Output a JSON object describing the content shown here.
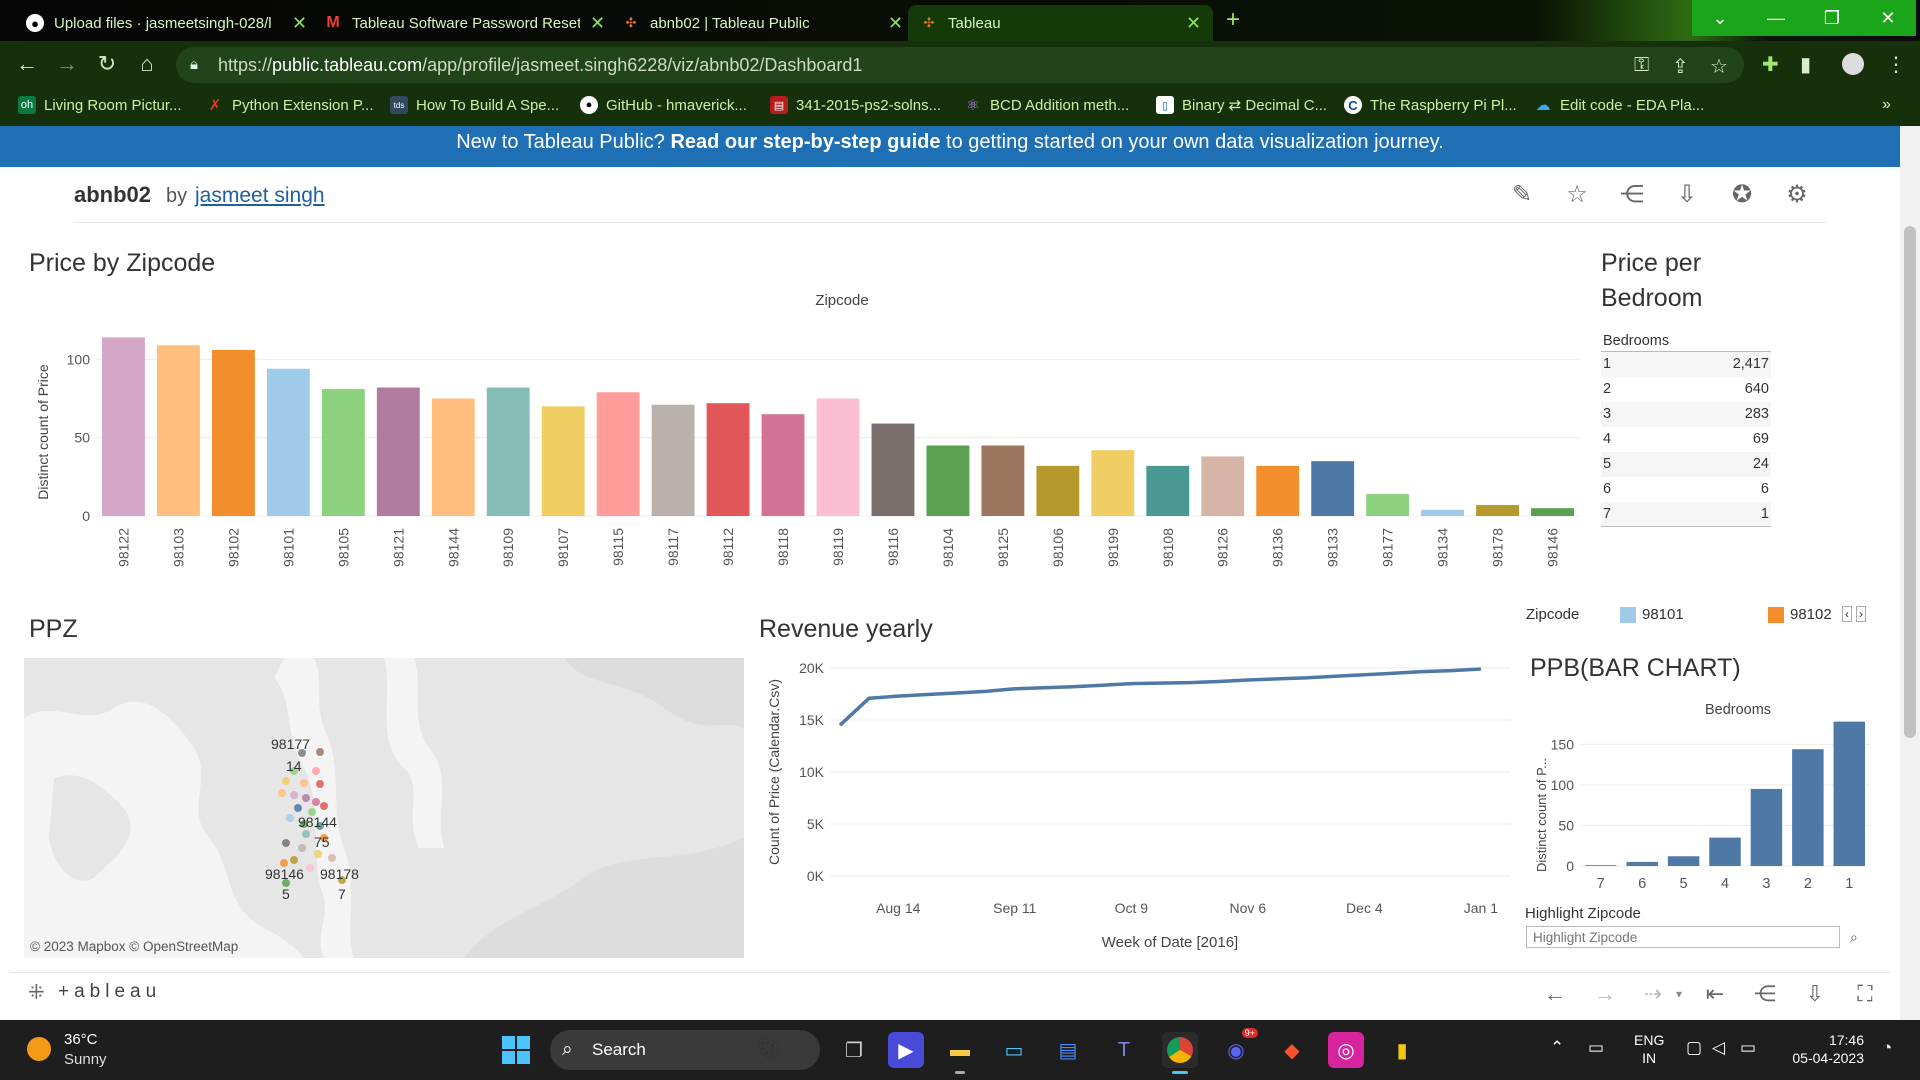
{
  "browser": {
    "tabs": [
      {
        "title": "Upload files · jasmeetsingh-028/l",
        "favicon": "github-icon",
        "active": false
      },
      {
        "title": "Tableau Software Password Reset",
        "favicon": "gmail-icon",
        "active": false
      },
      {
        "title": "abnb02 | Tableau Public",
        "favicon": "tableau-icon",
        "active": false
      },
      {
        "title": "Tableau",
        "favicon": "tableau-icon",
        "active": true
      }
    ],
    "url_prefix": "https://",
    "url_host": "public.tableau.com",
    "url_path": "/app/profile/jasmeet.singh6228/viz/abnb02/Dashboard1",
    "bookmarks": [
      {
        "label": "Living Room Pictur...",
        "icon": "oh-icon",
        "color": "#0b7a3e"
      },
      {
        "label": "Python Extension P...",
        "icon": "python-icon",
        "color": "#c0392b"
      },
      {
        "label": "How To Build A Spe...",
        "icon": "tds-icon",
        "color": "#34495e"
      },
      {
        "label": "GitHub - hmaverick...",
        "icon": "github-icon",
        "color": "#000000"
      },
      {
        "label": "341-2015-ps2-solns...",
        "icon": "pdf-icon",
        "color": "#b71c1c"
      },
      {
        "label": "BCD Addition meth...",
        "icon": "atom-icon",
        "color": "#6a1b9a"
      },
      {
        "label": "Binary ⇄ Decimal C...",
        "icon": "binary-icon",
        "color": "#1565c0"
      },
      {
        "label": "The Raspberry Pi Pl...",
        "icon": "c-icon",
        "color": "#0d47a1"
      },
      {
        "label": "Edit code - EDA Pla...",
        "icon": "eda-icon",
        "color": "#1e88e5"
      }
    ]
  },
  "banner": {
    "prefix": "New to Tableau Public? ",
    "bold": "Read our step-by-step guide",
    "suffix": " to getting started on your own data visualization journey."
  },
  "viz": {
    "title": "abnb02",
    "by": "by",
    "author": "jasmeet singh"
  },
  "sheets": {
    "price_by_zip": "Price by Zipcode",
    "price_per_bedroom": "Price per Bedroom",
    "ppz": "PPZ",
    "revenue_yearly": "Revenue yearly",
    "ppb_bar": "PPB(BAR CHART)"
  },
  "chart_data": [
    {
      "type": "bar",
      "title": "Price by Zipcode",
      "xlabel": "Zipcode",
      "ylabel": "Distinct count of Price",
      "ylim": [
        0,
        120
      ],
      "yticks": [
        0,
        50,
        100
      ],
      "categories": [
        "98122",
        "98103",
        "98102",
        "98101",
        "98105",
        "98121",
        "98144",
        "98109",
        "98107",
        "98115",
        "98117",
        "98112",
        "98118",
        "98119",
        "98116",
        "98104",
        "98125",
        "98106",
        "98199",
        "98108",
        "98126",
        "98136",
        "98133",
        "98177",
        "98134",
        "98178",
        "98146"
      ],
      "values": [
        114,
        109,
        106,
        94,
        81,
        82,
        75,
        82,
        70,
        79,
        71,
        72,
        65,
        75,
        59,
        45,
        45,
        32,
        42,
        32,
        38,
        32,
        35,
        14,
        4,
        7,
        5
      ],
      "colors": [
        "#d4a6c8",
        "#ffbe7d",
        "#f28e2b",
        "#a0cbe8",
        "#8cd17d",
        "#b07aa1",
        "#ffbe7d",
        "#86bcb6",
        "#f1ce63",
        "#ff9d9a",
        "#bab0ac",
        "#e15759",
        "#d37295",
        "#fabfd2",
        "#79706e",
        "#59a14f",
        "#9d7660",
        "#b6992d",
        "#f1ce63",
        "#499894",
        "#d7b5a6",
        "#f28e2b",
        "#4e79a7",
        "#8cd17d",
        "#a0cbe8",
        "#b6992d",
        "#59a14f"
      ]
    },
    {
      "type": "table",
      "title": "Price per Bedroom",
      "columns": [
        "Bedrooms",
        ""
      ],
      "rows": [
        [
          "1",
          "2,417"
        ],
        [
          "2",
          "640"
        ],
        [
          "3",
          "283"
        ],
        [
          "4",
          "69"
        ],
        [
          "5",
          "24"
        ],
        [
          "6",
          "6"
        ],
        [
          "7",
          "1"
        ]
      ]
    },
    {
      "type": "line",
      "title": "Revenue yearly",
      "xlabel": "Week of Date [2016]",
      "ylabel": "Count of Price (Calendar.Csv)",
      "ylim": [
        0,
        20000
      ],
      "yticks": [
        "0K",
        "5K",
        "10K",
        "15K",
        "20K"
      ],
      "xticks": [
        "Aug 14",
        "Sep 11",
        "Oct 9",
        "Nov 6",
        "Dec 4",
        "Jan 1"
      ],
      "x": [
        "2016-07-31",
        "2016-08-07",
        "2016-08-14",
        "2016-08-21",
        "2016-08-28",
        "2016-09-04",
        "2016-09-11",
        "2016-09-18",
        "2016-09-25",
        "2016-10-02",
        "2016-10-09",
        "2016-10-16",
        "2016-10-23",
        "2016-10-30",
        "2016-11-06",
        "2016-11-13",
        "2016-11-20",
        "2016-11-27",
        "2016-12-04",
        "2016-12-11",
        "2016-12-18",
        "2016-12-25",
        "2017-01-01"
      ],
      "values": [
        14500,
        17100,
        17300,
        17450,
        17600,
        17750,
        18000,
        18100,
        18200,
        18350,
        18500,
        18550,
        18600,
        18700,
        18850,
        18950,
        19050,
        19200,
        19350,
        19500,
        19650,
        19750,
        19900
      ],
      "color": "#4e79a7"
    },
    {
      "type": "bar",
      "title": "PPB(BAR CHART)",
      "xlabel": "Bedrooms",
      "ylabel": "Distinct count of P...",
      "ylim": [
        0,
        180
      ],
      "yticks": [
        0,
        50,
        100,
        150
      ],
      "categories": [
        "7",
        "6",
        "5",
        "4",
        "3",
        "2",
        "1"
      ],
      "values": [
        1,
        5,
        12,
        35,
        95,
        144,
        178
      ],
      "color": "#4e79a7"
    }
  ],
  "map": {
    "labels": [
      {
        "text": "98177"
      },
      {
        "text": "14"
      },
      {
        "text": "98144"
      },
      {
        "text": "75"
      },
      {
        "text": "98146"
      },
      {
        "text": "98178"
      },
      {
        "text": "5"
      },
      {
        "text": "7"
      }
    ],
    "attribution": "© 2023 Mapbox  © OpenStreetMap"
  },
  "legend": {
    "title": "Zipcode",
    "items": [
      {
        "label": "98101",
        "color": "#a0cbe8"
      },
      {
        "label": "98102",
        "color": "#f28e2b"
      }
    ]
  },
  "highlight": {
    "label": "Highlight Zipcode",
    "placeholder": "Highlight Zipcode"
  },
  "toolbar": {
    "logo": "+ableau"
  },
  "taskbar": {
    "temp": "36°C",
    "weather": "Sunny",
    "search": "Search",
    "lang1": "ENG",
    "lang2": "IN",
    "time": "17:46",
    "date": "05-04-2023",
    "badge": "9+"
  }
}
